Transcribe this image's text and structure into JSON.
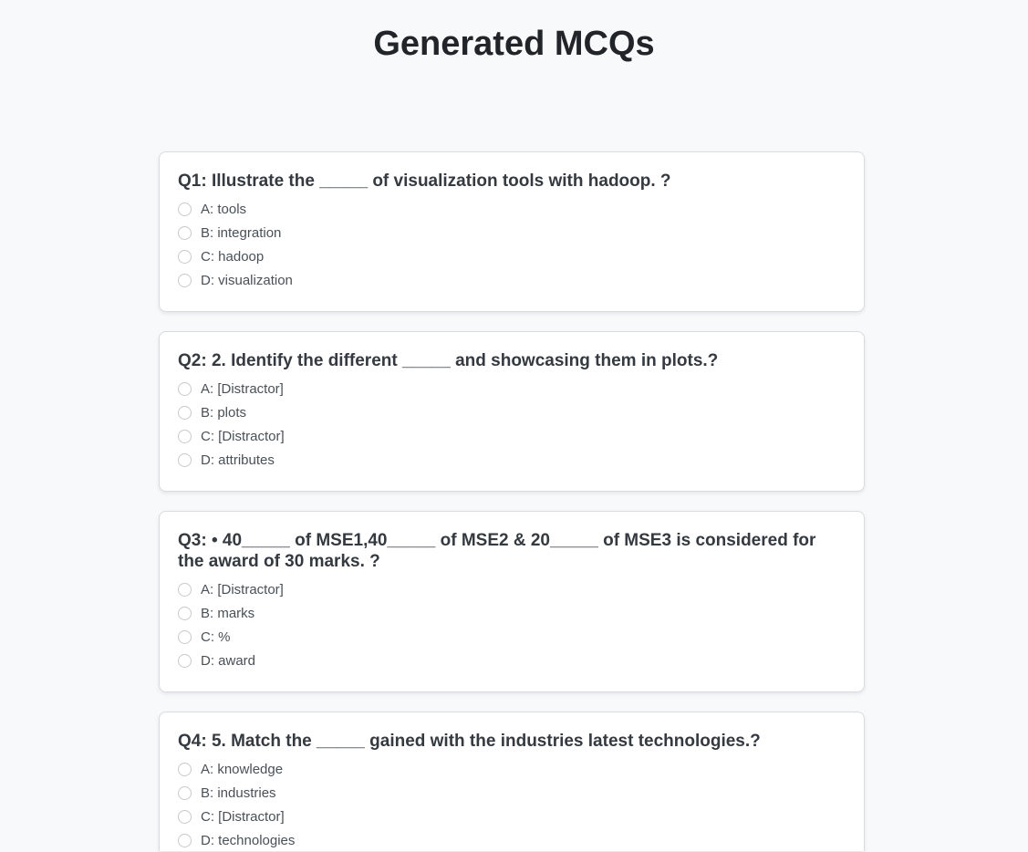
{
  "page": {
    "title": "Generated MCQs"
  },
  "questions": [
    {
      "text": "Q1: Illustrate the _____ of visualization tools with hadoop. ?",
      "options": [
        "A: tools",
        "B: integration",
        "C: hadoop",
        "D: visualization"
      ]
    },
    {
      "text": "Q2: 2. Identify the different _____ and showcasing them in plots.?",
      "options": [
        "A: [Distractor]",
        "B: plots",
        "C: [Distractor]",
        "D: attributes"
      ]
    },
    {
      "text": "Q3: • 40_____ of MSE1,40_____ of MSE2 & 20_____ of MSE3 is considered for the award of 30 marks. ?",
      "options": [
        "A: [Distractor]",
        "B: marks",
        "C: %",
        "D: award"
      ]
    },
    {
      "text": "Q4: 5. Match the _____ gained with the industries latest technologies.?",
      "options": [
        "A: knowledge",
        "B: industries",
        "C: [Distractor]",
        "D: technologies"
      ]
    }
  ]
}
